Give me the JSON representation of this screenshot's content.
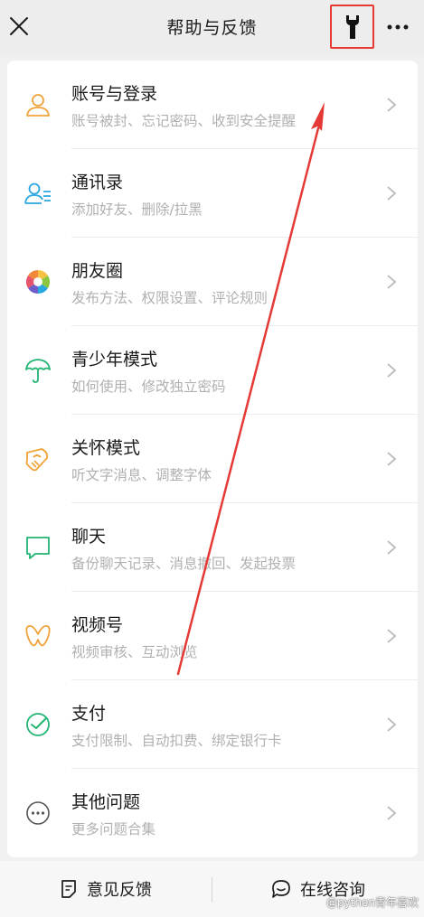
{
  "header": {
    "title": "帮助与反馈"
  },
  "items": [
    {
      "label": "账号与登录",
      "desc": "账号被封、忘记密码、收到安全提醒",
      "icon": "user-icon",
      "color": "#f0a33a"
    },
    {
      "label": "通讯录",
      "desc": "添加好友、删除/拉黑",
      "icon": "contacts-icon",
      "color": "#2aa6e0"
    },
    {
      "label": "朋友圈",
      "desc": "发布方法、权限设置、评论规则",
      "icon": "moments-icon",
      "color": "#f0a33a"
    },
    {
      "label": "青少年模式",
      "desc": "如何使用、修改独立密码",
      "icon": "umbrella-icon",
      "color": "#22b573"
    },
    {
      "label": "关怀模式",
      "desc": "听文字消息、调整字体",
      "icon": "care-icon",
      "color": "#f0a33a"
    },
    {
      "label": "聊天",
      "desc": "备份聊天记录、消息撤回、发起投票",
      "icon": "chat-icon",
      "color": "#22b573"
    },
    {
      "label": "视频号",
      "desc": "视频审核、互动浏览",
      "icon": "channels-icon",
      "color": "#f0a33a"
    },
    {
      "label": "支付",
      "desc": "支付限制、自动扣费、绑定银行卡",
      "icon": "pay-icon",
      "color": "#22b573"
    },
    {
      "label": "其他问题",
      "desc": "更多问题合集",
      "icon": "more-circle-icon",
      "color": "#333333"
    }
  ],
  "bottom": {
    "feedback": "意见反馈",
    "consult": "在线咨询"
  },
  "watermark": "@python青年喜欢",
  "colors": {
    "highlight": "#e53935"
  }
}
